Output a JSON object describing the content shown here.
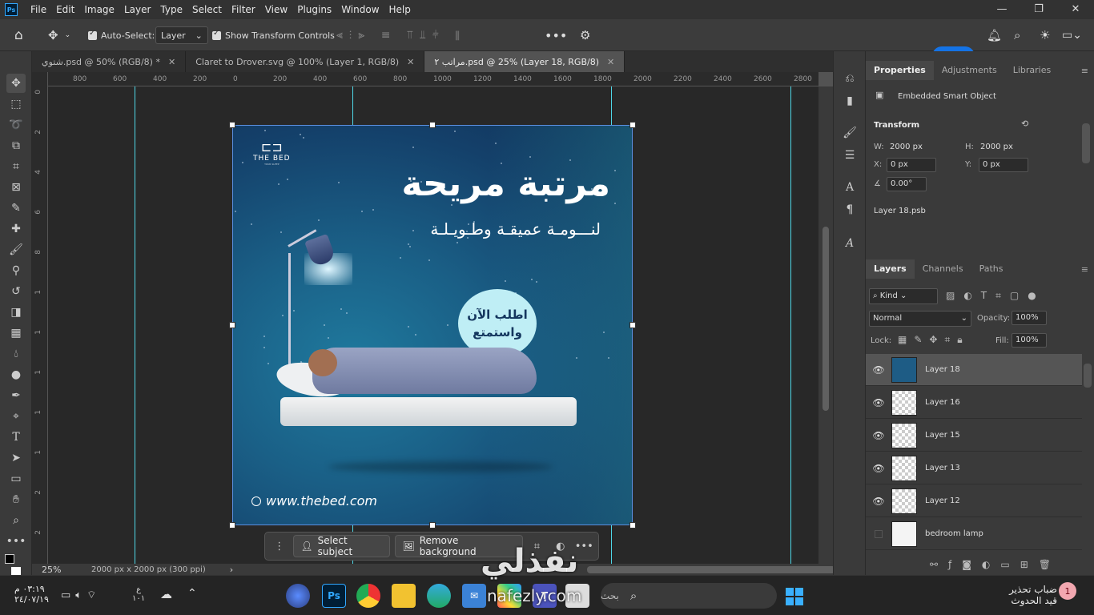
{
  "menubar": {
    "logo": "Ps",
    "items": [
      "File",
      "Edit",
      "Image",
      "Layer",
      "Type",
      "Select",
      "Filter",
      "View",
      "Plugins",
      "Window",
      "Help"
    ]
  },
  "options": {
    "auto_select_label": "Auto-Select:",
    "auto_select_value": "Layer",
    "show_transform_label": "Show Transform Controls",
    "share_label": "Share"
  },
  "tabs": [
    {
      "label": "شتوي.psd @ 50% (RGB/8) *",
      "active": false
    },
    {
      "label": "Claret to Drover.svg @ 100% (Layer 1, RGB/8)",
      "active": false
    },
    {
      "label": "مراتب ٢.psd @ 25% (Layer 18, RGB/8)",
      "active": true
    }
  ],
  "ruler": {
    "h_ticks": [
      "800",
      "600",
      "400",
      "200",
      "0",
      "200",
      "400",
      "600",
      "800",
      "1000",
      "1200",
      "1400",
      "1600",
      "1800",
      "2000",
      "2200",
      "2400",
      "2600",
      "2800"
    ],
    "v_ticks": [
      "0",
      "2",
      "4",
      "6",
      "8",
      "1",
      "1",
      "1",
      "1",
      "1",
      "2",
      "2"
    ]
  },
  "artwork": {
    "brand_name": "THE BED",
    "brand_sub": "YOUR SLEEP",
    "headline": "مرتبة مريحة",
    "subline": "لنـــومـة عميقـة وطـويـلـة",
    "cta_line1": "اطلب الآن",
    "cta_line2": "واستمتع",
    "website": "www.thebed.com"
  },
  "contextbar": {
    "select_subject": "Select subject",
    "remove_background": "Remove background"
  },
  "status": {
    "zoom": "25%",
    "doc_info": "2000 px x 2000 px (300 ppi)"
  },
  "properties": {
    "tabs": [
      "Properties",
      "Adjustments",
      "Libraries"
    ],
    "object_type": "Embedded Smart Object",
    "transform_title": "Transform",
    "w_label": "W:",
    "w_value": "2000 px",
    "h_label": "H:",
    "h_value": "2000 px",
    "x_label": "X:",
    "x_value": "0 px",
    "y_label": "Y:",
    "y_value": "0 px",
    "angle_value": "0.00°",
    "linked_file": "Layer 18.psb"
  },
  "layers_panel": {
    "tabs": [
      "Layers",
      "Channels",
      "Paths"
    ],
    "kind_label": "Kind",
    "blend_mode": "Normal",
    "opacity_label": "Opacity:",
    "opacity_value": "100%",
    "lock_label": "Lock:",
    "fill_label": "Fill:",
    "fill_value": "100%",
    "layers": [
      {
        "name": "Layer 18",
        "visible": true,
        "selected": true
      },
      {
        "name": "Layer 16",
        "visible": true,
        "selected": false
      },
      {
        "name": "Layer 15",
        "visible": true,
        "selected": false
      },
      {
        "name": "Layer 13",
        "visible": true,
        "selected": false
      },
      {
        "name": "Layer 12",
        "visible": true,
        "selected": false
      },
      {
        "name": "bedroom lamp",
        "visible": false,
        "selected": false
      }
    ]
  },
  "taskbar": {
    "time": "٠٣:١٩ م",
    "date": "٢٤/٠٧/١٩",
    "lang_top": "ع",
    "lang_bottom": "١٠١",
    "search_placeholder": "بحث",
    "weather_title": "ضباب تحذير",
    "weather_sub": "قيد الحدوث",
    "notif_count": "1"
  },
  "watermark": {
    "main": "نفذلي",
    "sub": "nafezly.com"
  }
}
